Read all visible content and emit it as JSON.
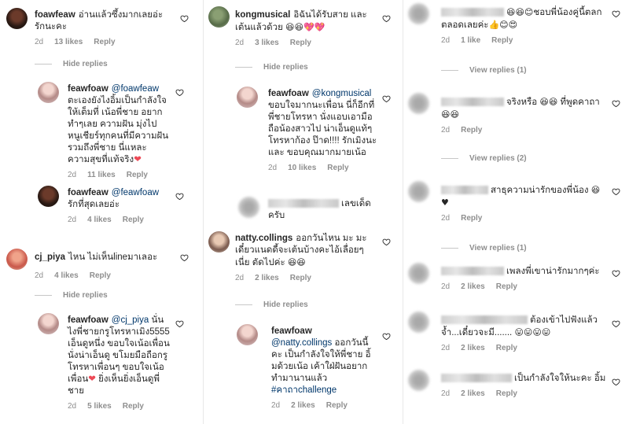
{
  "labels": {
    "hide_replies": "Hide replies",
    "reply": "Reply"
  },
  "col1": {
    "c1": {
      "user": "foawfeaw",
      "text": "อ่านแล้วซึ้งมากเลยอ่ะ รักนะคะ",
      "time": "2d",
      "likes": "13 likes"
    },
    "r1": {
      "user": "feawfoaw",
      "mention": "@foawfeaw",
      "text": "ตะเองยังไงอิ้มเป็นกำลังใจให้เต็มที่ เน้อพี่ชาย อยากทำๆเลย ความฝัน มุ่งไป หนูเชียร์ทุกคนที่มีความฝัน รวมถึงพี่ชาย นี่แหละ ความสุขที่แท้จริง",
      "emoji": "❤",
      "time": "2d",
      "likes": "11 likes"
    },
    "r2": {
      "user": "foawfeaw",
      "mention": "@feawfoaw",
      "text": "รักที่สุดเลยอ่ะ",
      "time": "2d",
      "likes": "4 likes"
    },
    "c2": {
      "user": "cj_piya",
      "text": "ไหน ไม่เห็นlineมาเลอะ",
      "time": "2d",
      "likes": "4 likes"
    },
    "r3": {
      "user": "feawfoaw",
      "mention": "@cj_piya",
      "text": "นั่นไงพี่ชายกรูโทรหาเมิง5555 เอ็นดูหนึ่ง ขอบใจเน้อเพื่อน นั่งน่าเอ็นดู ขโมยมือถือกรูโทรหาเพื่อนๆ ขอบใจเน้อเพื่อน",
      "emoji": "❤",
      "text2": "ยิ่งเห็นยิ่งเอ็นดูพี่ชาย",
      "time": "2d",
      "likes": "5 likes"
    }
  },
  "col2": {
    "c1": {
      "user": "kongmusical",
      "text": "อิฉันได้รับสาย และเต้นแล้วด้วย",
      "emoji": "😆😆💖💖",
      "time": "2d",
      "likes": "3 likes"
    },
    "r1": {
      "user": "feawfoaw",
      "mention": "@kongmusical",
      "text": "ขอบใจมากนะเพื่อน นี่ก็อีกที่พี่ชายโทรหา นั่งแอบเอามือถือน้องสาวไป น่าเอ็นดูแท้ๆ โทรหาก้อง ป๊าด!!!! รักเมิงนะ และ ขอบคุณมากมายเน้อ",
      "time": "2d",
      "likes": "10 likes"
    },
    "c2": {
      "text": "เลขเด็ด ครับ"
    },
    "c3": {
      "user": "natty.collings",
      "text": "ออกวันไหน มะ มะเดี๋ยวแนดดี้จะเต้นบ้างคะไอ้เลื่อยๆเนี่ย ตัดไปค่ะ",
      "emoji": "😆😆",
      "time": "2d",
      "likes": "2 likes"
    },
    "r2": {
      "user": "feawfoaw",
      "mention": "@natty.collings",
      "text": "ออกวันนี้คะ เป็นกำลังใจให้พี่ชาย อิ้มด้วยเน้อ เค้าใฝ่ฝันอยากทำมานานแล้ว",
      "hashtag": "#คาถาchallenge",
      "time": "2d",
      "likes": "2 likes"
    }
  },
  "col3": {
    "c1": {
      "text": "ชอบพี่น้องคู่นี้ตลกตลอดเลยค่ะ",
      "emoji_a": "😆😆😊",
      "emoji_b": "👍😊😍",
      "time": "2d",
      "likes": "1 like",
      "view": "View replies (1)"
    },
    "c2": {
      "text": "จริงหรือ",
      "text2": "ที่พูดคาถา",
      "emoji_a": "😆😆",
      "emoji_b": "😆😆",
      "time": "2d",
      "view": "View replies (2)"
    },
    "c3": {
      "text": "สาธุความน่ารักของพี่น้อง",
      "emoji": "😆♥",
      "time": "2d",
      "view": "View replies (1)"
    },
    "c4": {
      "text": "เพลงพี่เขาน่ารักมากๆค่ะ",
      "time": "2d",
      "likes": "2 likes"
    },
    "c5": {
      "text": "ต้องเข้าไปฟังแล้วจ้ำ...เดี๋ยวจะมี.......",
      "emoji": "😛😛😛😛",
      "time": "2d",
      "likes": "2 likes"
    },
    "c6": {
      "text": "เป็นกำลังใจให้นะคะ อิ้ม",
      "time": "2d",
      "likes": "2 likes"
    }
  }
}
